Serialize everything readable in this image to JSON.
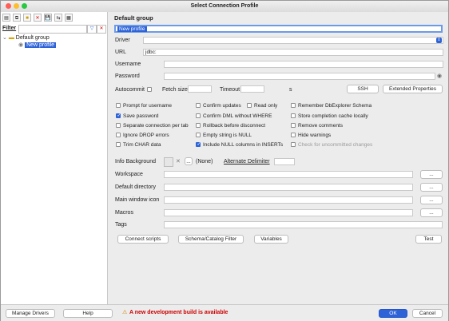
{
  "window": {
    "title": "Select Connection Profile"
  },
  "colors": {
    "accent": "#2e63d8",
    "warning": "#cc0000"
  },
  "left": {
    "filter_label": "Filter",
    "tree": {
      "group": "Default group",
      "profile": "New profile"
    }
  },
  "right": {
    "group_title": "Default group",
    "profile_name": "New profile",
    "driver_label": "Driver",
    "url_label": "URL",
    "url_value": "jdbc:",
    "username_label": "Username",
    "password_label": "Password",
    "autocommit_label": "Autocommit",
    "fetch_size_label": "Fetch size",
    "timeout_label": "Timeout",
    "timeout_unit": "s",
    "ssh_label": "SSH",
    "extended_properties_label": "Extended Properties",
    "checkboxes": [
      {
        "label": "Prompt for username",
        "checked": false
      },
      {
        "label": "Confirm updates",
        "checked": false
      },
      {
        "label": "Read only",
        "checked": false
      },
      {
        "label": "Remember DbExplorer Schema",
        "checked": false
      },
      {
        "label": "Save password",
        "checked": true
      },
      {
        "label": "Confirm DML without WHERE",
        "checked": false
      },
      {
        "label": "Store completion cache locally",
        "checked": false
      },
      {
        "label": "Separate connection per tab",
        "checked": false
      },
      {
        "label": "Rollback before disconnect",
        "checked": false
      },
      {
        "label": "Remove comments",
        "checked": false
      },
      {
        "label": "Ignore DROP errors",
        "checked": false
      },
      {
        "label": "Empty string is NULL",
        "checked": false
      },
      {
        "label": "Hide warnings",
        "checked": false
      },
      {
        "label": "Trim CHAR data",
        "checked": false
      },
      {
        "label": "Include NULL columns in INSERTs",
        "checked": true
      },
      {
        "label": "Check for uncommitted changes",
        "checked": false,
        "disabled": true
      }
    ],
    "info_background_label": "Info Background",
    "info_none": "(None)",
    "alternate_delimiter_label": "Alternate Delimiter",
    "workspace_label": "Workspace",
    "default_directory_label": "Default directory",
    "main_window_icon_label": "Main window icon",
    "macros_label": "Macros",
    "tags_label": "Tags",
    "ellipsis": "...",
    "connect_scripts_label": "Connect scripts",
    "schema_catalog_filter_label": "Schema/Catalog Filter",
    "variables_label": "Variables",
    "test_label": "Test"
  },
  "bottom": {
    "manage_drivers_label": "Manage Drivers",
    "help_label": "Help",
    "warning_text": "A new development build is available",
    "ok_label": "OK",
    "cancel_label": "Cancel"
  }
}
